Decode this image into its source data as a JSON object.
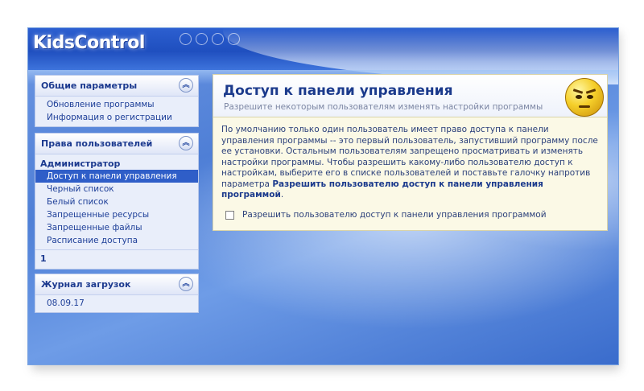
{
  "app": {
    "logo_text": "KidsControl"
  },
  "sidebar": {
    "panels": [
      {
        "title": "Общие параметры",
        "items": [
          "Обновление программы",
          "Информация о регистрации"
        ]
      },
      {
        "title": "Права пользователей",
        "subheading": "Администратор",
        "items": [
          "Доступ к панели управления",
          "Черный список",
          "Белый список",
          "Запрещенные ресурсы",
          "Запрещенные файлы",
          "Расписание доступа"
        ],
        "selected_item": "Доступ к панели управления",
        "page_number": "1"
      },
      {
        "title": "Журнал загрузок",
        "items": [
          "08.09.17"
        ]
      }
    ],
    "collapse_glyph": "︽"
  },
  "content": {
    "title": "Доступ к панели управления",
    "subtitle": "Разрешите некоторым пользователям изменять настройки программы",
    "description_part1": "По умолчанию только один пользователь имеет право доступа к панели управления программы -- это первый пользователь, запустивший программу после ее установки. Остальным пользователям запрещено просматривать и изменять настройки программы. Чтобы разрешить какому-либо пользователю доступ к настройкам, выберите его в списке пользователей и поставьте галочку напротив параметра ",
    "description_bold": "Разрешить пользователю доступ к панели управления программой",
    "description_end": ".",
    "checkbox_label": "Разрешить пользователю доступ к панели управления программой",
    "checkbox_checked": false,
    "mascot_icon": "angry-smiley-icon"
  },
  "colors": {
    "accent": "#2f5ec8",
    "title_blue": "#1b3a8c",
    "content_bg": "#fbf9e6"
  }
}
